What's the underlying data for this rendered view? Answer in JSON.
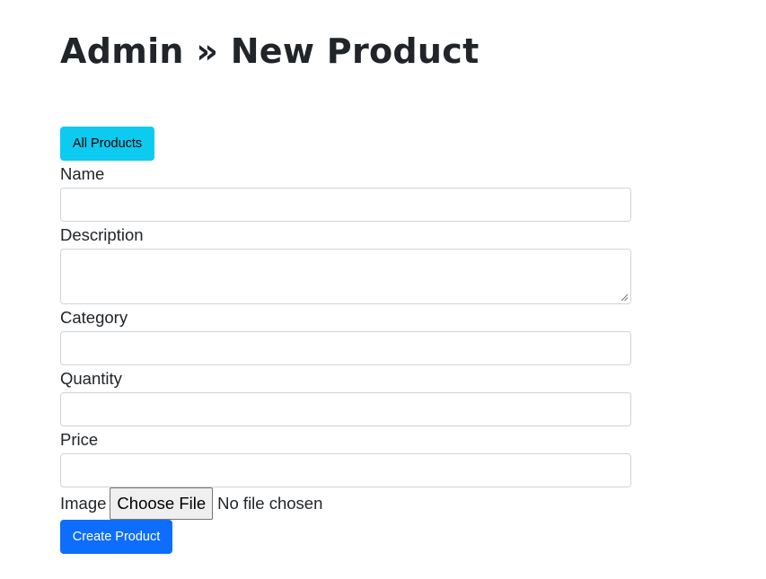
{
  "page": {
    "title": "Admin » New Product"
  },
  "toolbar": {
    "all_products_label": "All Products"
  },
  "form": {
    "name": {
      "label": "Name",
      "value": ""
    },
    "description": {
      "label": "Description",
      "value": ""
    },
    "category": {
      "label": "Category",
      "value": ""
    },
    "quantity": {
      "label": "Quantity",
      "value": ""
    },
    "price": {
      "label": "Price",
      "value": ""
    },
    "image": {
      "label": "Image",
      "button_label": "Choose File",
      "status": "No file chosen"
    },
    "submit_label": "Create Product"
  },
  "colors": {
    "info_button": "#0dcaf0",
    "primary_button": "#0d6efd",
    "input_border": "#ced4da",
    "text": "#212529"
  }
}
